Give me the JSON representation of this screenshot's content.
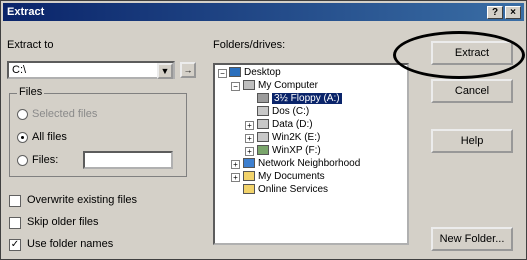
{
  "window": {
    "title": "Extract",
    "help_glyph": "?",
    "close_glyph": "×"
  },
  "left": {
    "extract_to_label": "Extract to",
    "extract_to_value": "C:\\",
    "files_group_label": "Files",
    "radio_selected_files": "Selected files",
    "radio_all_files": "All files",
    "radio_files": "Files:",
    "files_value": "",
    "overwrite_label": "Overwrite existing files",
    "skip_older_label": "Skip older files",
    "use_folder_names_label": "Use folder names",
    "use_folder_names_checked": "✓"
  },
  "tree": {
    "label": "Folders/drives:",
    "nodes": [
      {
        "label": "Desktop",
        "expander": "−"
      },
      {
        "label": "My Computer",
        "expander": "−"
      },
      {
        "label": "3½ Floppy (A:)",
        "expander": ""
      },
      {
        "label": "Dos (C:)",
        "expander": ""
      },
      {
        "label": "Data (D:)",
        "expander": "+"
      },
      {
        "label": "Win2K (E:)",
        "expander": "+"
      },
      {
        "label": "WinXP (F:)",
        "expander": "+"
      },
      {
        "label": "Network Neighborhood",
        "expander": "+"
      },
      {
        "label": "My Documents",
        "expander": "+"
      },
      {
        "label": "Online Services",
        "expander": ""
      }
    ]
  },
  "buttons": {
    "extract": "Extract",
    "cancel": "Cancel",
    "help": "Help",
    "new_folder": "New Folder..."
  }
}
